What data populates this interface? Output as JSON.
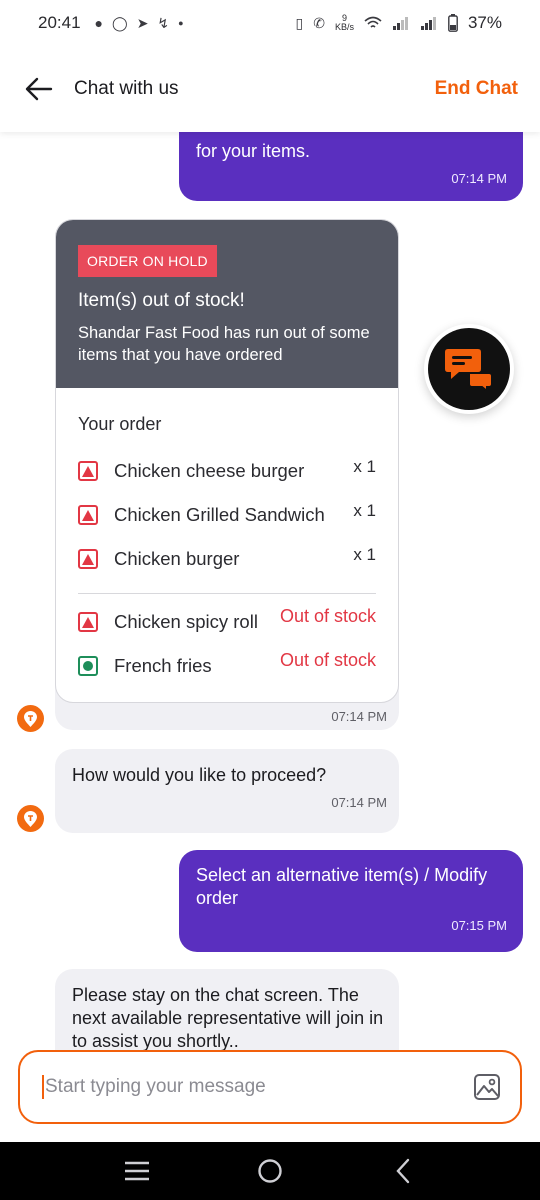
{
  "status_bar": {
    "time": "20:41",
    "network_speed_value": "9",
    "network_speed_unit": "KB/s",
    "battery": "37%"
  },
  "header": {
    "title": "Chat with us",
    "end_chat_label": "End Chat"
  },
  "messages": {
    "first_user": {
      "partial_text": "for your items.",
      "time": "07:14 PM"
    },
    "order_card": {
      "badge": "ORDER ON HOLD",
      "title": "Item(s) out of stock!",
      "description": "Shandar Fast Food has run out of some items that you have ordered",
      "your_order_label": "Your order",
      "items": [
        {
          "name": "Chicken cheese burger",
          "qty": "x 1",
          "type": "non-veg"
        },
        {
          "name": "Chicken Grilled Sandwich",
          "qty": "x 1",
          "type": "non-veg"
        },
        {
          "name": "Chicken burger",
          "qty": "x 1",
          "type": "non-veg"
        }
      ],
      "out_of_stock_items": [
        {
          "name": "Chicken spicy roll",
          "status": "Out of stock",
          "type": "non-veg"
        },
        {
          "name": "French fries",
          "status": "Out of stock",
          "type": "veg"
        }
      ],
      "time": "07:14 PM"
    },
    "proceed_question": {
      "text": "How would you like to proceed?",
      "time": "07:14 PM"
    },
    "user_choice": {
      "text": "Select an alternative item(s) / Modify order",
      "time": "07:15 PM"
    },
    "stay_message": {
      "text": "Please stay on the chat screen. The next available representative will join in to assist you shortly.."
    }
  },
  "input": {
    "placeholder": "Start typing your message"
  },
  "colors": {
    "accent": "#f2600c",
    "user_bubble": "#5a2fbf",
    "bot_bubble": "#f0f0f4",
    "card_header": "#545763",
    "alert_red": "#e23744",
    "veg_green": "#1e8e5a"
  },
  "icons": [
    "back-arrow-icon",
    "image-icon",
    "chat-support-icon",
    "swiggy-logo-icon",
    "nav-recents-icon",
    "nav-home-icon",
    "nav-back-icon"
  ]
}
